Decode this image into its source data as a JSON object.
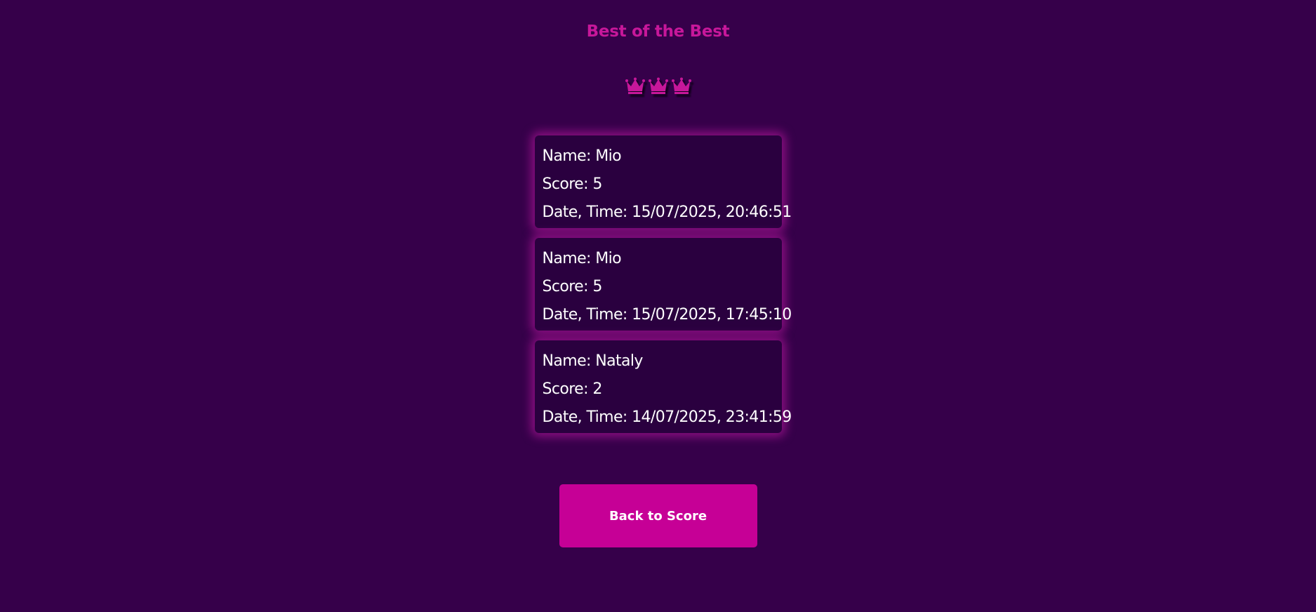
{
  "header": {
    "title": "Best of the Best"
  },
  "crowns": {
    "icons": [
      "crown-icon",
      "crown-icon",
      "crown-icon"
    ],
    "color": "#c7179a"
  },
  "scores": [
    {
      "name_label": "Name: Mio",
      "score_label": "Score: 5",
      "datetime_label": "Date, Time: 15/07/2025, 20:46:51"
    },
    {
      "name_label": "Name: Mio",
      "score_label": "Score: 5",
      "datetime_label": "Date, Time: 15/07/2025, 17:45:10"
    },
    {
      "name_label": "Name: Nataly",
      "score_label": "Score: 2",
      "datetime_label": "Date, Time: 14/07/2025, 23:41:59"
    }
  ],
  "footer": {
    "back_label": "Back to Score"
  },
  "colors": {
    "background": "#36004a",
    "card": "#2a003f",
    "accent": "#c60096",
    "title": "#c7179a"
  }
}
